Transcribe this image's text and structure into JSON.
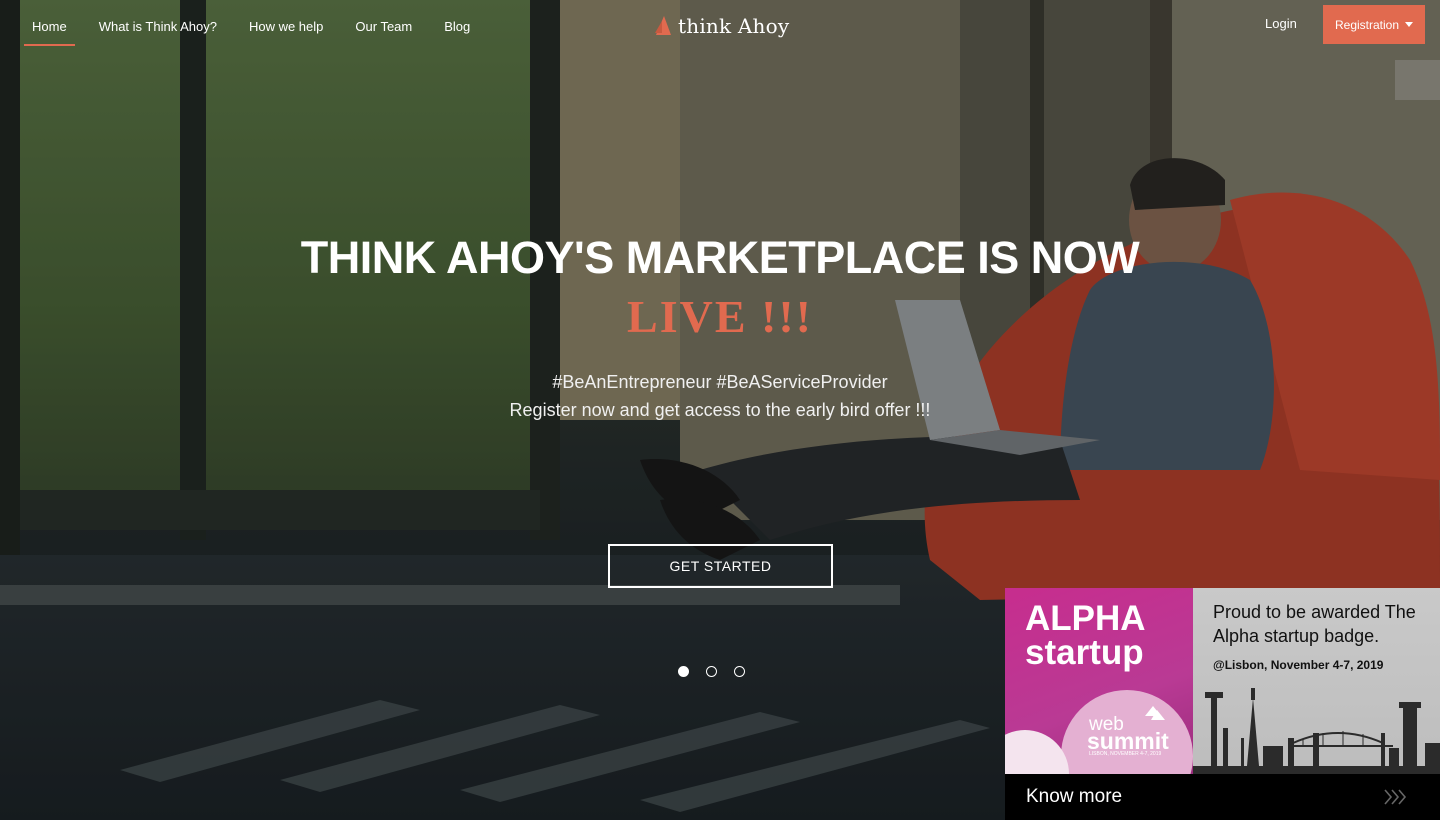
{
  "nav": {
    "links": [
      {
        "label": "Home",
        "active": true
      },
      {
        "label": "What is Think Ahoy?"
      },
      {
        "label": "How we help"
      },
      {
        "label": "Our Team"
      },
      {
        "label": "Blog"
      }
    ],
    "logo_text": "think Ahoy",
    "login_label": "Login",
    "registration_label": "Registration"
  },
  "hero": {
    "headline": "THINK AHOY'S MARKETPLACE IS NOW",
    "live_text": "LIVE !!!",
    "hashtags": "#BeAnEntrepreneur #BeAServiceProvider",
    "subline": "Register now and get access to the early bird offer !!!",
    "cta_label": "GET STARTED",
    "slide_count": 3,
    "active_slide": 1
  },
  "promo": {
    "badge_line1": "ALPHA",
    "badge_line2": "startup",
    "badge_brand_line1": "web",
    "badge_brand_line2": "summit",
    "badge_caption": "LISBON, NOVEMBER 4-7, 2019",
    "text": "Proud to be awarded The Alpha startup badge.",
    "date_line": "@Lisbon, November 4-7, 2019",
    "cta_label": "Know more"
  },
  "colors": {
    "accent": "#e16a4f",
    "badge_pink": "#c72d8e",
    "promo_gray": "#c4c4c4"
  },
  "icons": {
    "logo": "sail-icon",
    "registration": "caret-down-icon",
    "know_more": "triple-chevron-right-icon"
  }
}
